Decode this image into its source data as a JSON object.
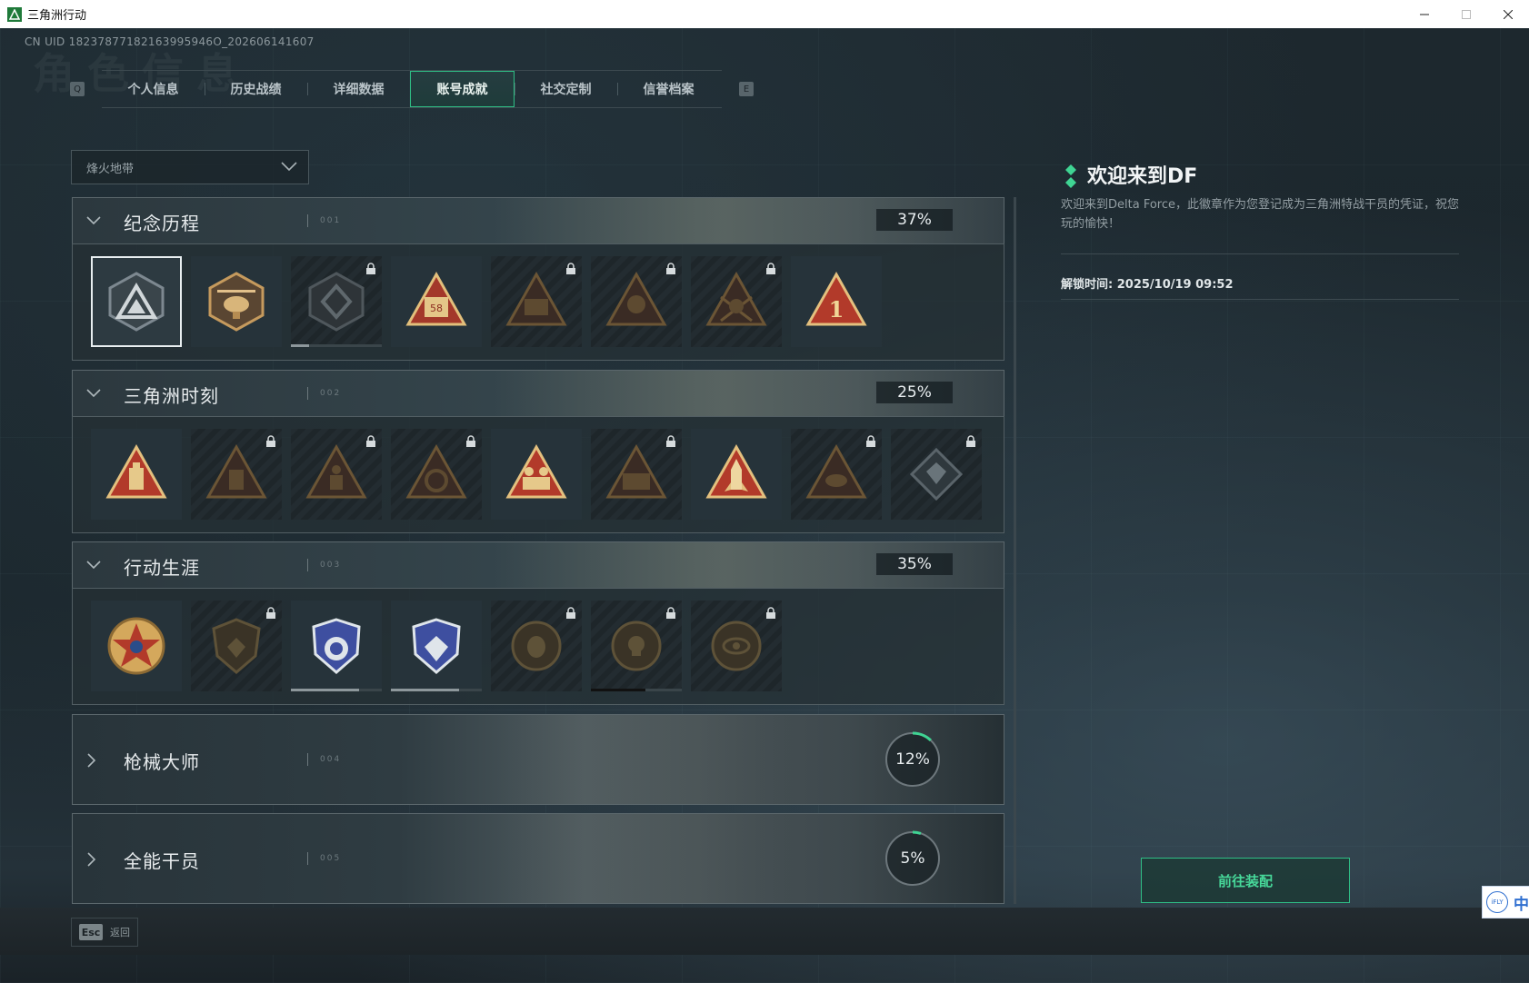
{
  "window": {
    "title": "三角洲行动"
  },
  "uid": "CN UID 18237877182163995946O_202606141607",
  "ghost_title": "角色信息",
  "tabs": {
    "prev_key": "Q",
    "next_key": "E",
    "items": [
      {
        "label": "个人信息"
      },
      {
        "label": "历史战绩"
      },
      {
        "label": "详细数据"
      },
      {
        "label": "账号成就",
        "active": true
      },
      {
        "label": "社交定制"
      },
      {
        "label": "信誉档案"
      }
    ]
  },
  "mode_select": {
    "value": "烽火地带"
  },
  "sections": [
    {
      "label": "纪念历程",
      "code": "001",
      "progress": "37%",
      "badges": [
        {
          "icon": "delta-logo-badge-icon",
          "locked": false,
          "selected": true
        },
        {
          "icon": "helicopter-badge-icon",
          "locked": false
        },
        {
          "icon": "shield-emblem-badge-icon",
          "locked": true,
          "progress": 0.2
        },
        {
          "icon": "bus-58-badge-icon",
          "locked": false
        },
        {
          "icon": "vehicle-badge-icon",
          "locked": true
        },
        {
          "icon": "operator-badge-icon",
          "locked": true
        },
        {
          "icon": "skull-badge-icon",
          "locked": true
        },
        {
          "icon": "number-one-badge-icon",
          "locked": false
        }
      ]
    },
    {
      "label": "三角洲时刻",
      "code": "002",
      "progress": "25%",
      "badges": [
        {
          "icon": "usb-drive-badge-icon",
          "locked": false
        },
        {
          "icon": "device-badge-icon",
          "locked": true
        },
        {
          "icon": "kneeling-soldier-badge-icon",
          "locked": true
        },
        {
          "icon": "wreath-badge-icon",
          "locked": true
        },
        {
          "icon": "squad-badge-icon",
          "locked": false
        },
        {
          "icon": "team-badge-icon",
          "locked": true
        },
        {
          "icon": "rocket-badge-icon",
          "locked": false
        },
        {
          "icon": "fish-badge-icon",
          "locked": true
        },
        {
          "icon": "diamond-badge-icon",
          "locked": true
        }
      ]
    },
    {
      "label": "行动生涯",
      "code": "003",
      "progress": "35%",
      "badges": [
        {
          "icon": "star-medal-badge-icon",
          "locked": false
        },
        {
          "icon": "dark-shield-badge-icon",
          "locked": true
        },
        {
          "icon": "police-shield-badge-icon",
          "locked": false,
          "progress": 0.75
        },
        {
          "icon": "diamond-shield-badge-icon",
          "locked": false,
          "progress": 0.75
        },
        {
          "icon": "helmet-coin-badge-icon",
          "locked": true
        },
        {
          "icon": "skull-coin-badge-icon",
          "locked": true,
          "progress": 0.6
        },
        {
          "icon": "eye-coin-badge-icon",
          "locked": true
        }
      ]
    },
    {
      "label": "枪械大师",
      "code": "004",
      "progress": "12%",
      "progress_value": 0.12
    },
    {
      "label": "全能干员",
      "code": "005",
      "progress": "5%",
      "progress_value": 0.05
    }
  ],
  "detail": {
    "title": "欢迎来到DF",
    "description": "欢迎来到Delta Force，此徽章作为您登记成为三角洲特战干员的凭证，祝您玩的愉快！",
    "unlock_time": "解锁时间: 2025/10/19 09:52",
    "equip_button": "前往装配"
  },
  "footer": {
    "esc_key": "Esc",
    "back_label": "返回"
  },
  "ime": {
    "label": "中",
    "logo": "iFLY"
  },
  "colors": {
    "accent": "#2fbf86",
    "accent_text": "#47d89a",
    "badge_red": "#b23a2a",
    "badge_gold": "#d9b36a"
  }
}
